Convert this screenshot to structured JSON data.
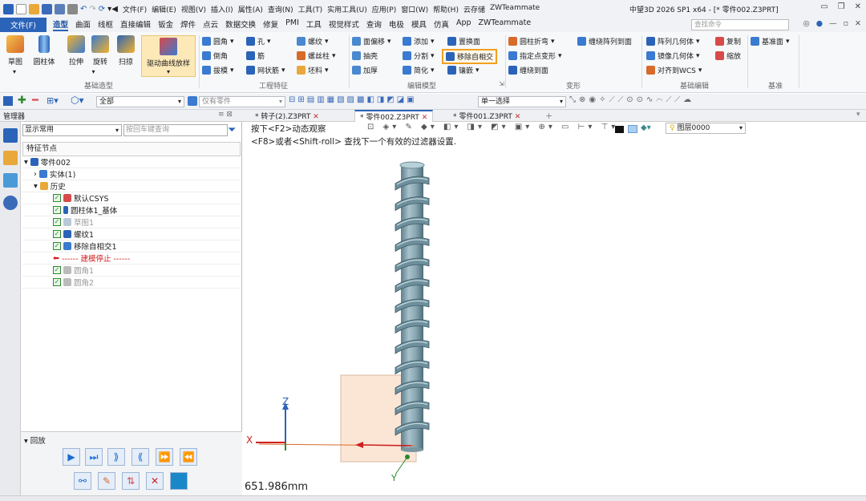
{
  "titlebar": {
    "menus": [
      "文件(F)",
      "编辑(E)",
      "视图(V)",
      "插入(I)",
      "属性(A)",
      "查询(N)",
      "工具(T)",
      "实用工具(U)",
      "应用(P)",
      "窗口(W)",
      "帮助(H)",
      "云存储",
      "ZWTeammate"
    ],
    "window_title": "中望3D 2026 SP1 x64 - [* 零件002.Z3PRT]"
  },
  "tabbar": {
    "file": "文件(F)",
    "tabs": [
      "造型",
      "曲面",
      "线框",
      "直接编辑",
      "钣金",
      "焊件",
      "点云",
      "数据交换",
      "修复",
      "PMI",
      "工具",
      "视觉样式",
      "查询",
      "电极",
      "模具",
      "仿真",
      "App",
      "ZWTeammate"
    ],
    "active": "造型",
    "search_placeholder": "查找命令"
  },
  "ribbon": {
    "big": [
      "草图",
      "圆柱体",
      "拉伸",
      "旋转",
      "扫掠"
    ],
    "drive": "驱动曲线放样",
    "groups": [
      "基础造型",
      "工程特征",
      "编辑模型",
      "变形",
      "基础编辑",
      "基准"
    ],
    "eng": [
      "圆角",
      "孔",
      "螺纹",
      "倒角",
      "筋",
      "螺丝柱",
      "拔模",
      "网状筋",
      "坯料"
    ],
    "edit": [
      "面偏移",
      "添加",
      "置换面",
      "抽壳",
      "分割",
      "移除自相交",
      "加厚",
      "简化",
      "镶嵌"
    ],
    "deform": [
      "圆柱折弯",
      "缠绕阵列到面",
      "指定点变形",
      "缠绕到面"
    ],
    "basic": [
      "阵列几何体",
      "复制",
      "镜像几何体",
      "缩放",
      "对齐到WCS"
    ],
    "datum": "基准面"
  },
  "toolbar2": {
    "filter": "全部",
    "parts": "仅有零件",
    "select": "单一选择"
  },
  "doctabs": {
    "manager": "管理器",
    "tabs": [
      "* 转子(2).Z3PRT",
      "* 零件002.Z3PRT",
      "* 零件001.Z3PRT"
    ]
  },
  "panel": {
    "filter": "显示常用",
    "search": "按回车键查询",
    "header": "特征节点",
    "tree": {
      "root": "零件002",
      "solid": "实体(1)",
      "history": "历史",
      "items": [
        "默认CSYS",
        "圆柱体1_基体",
        "草图1",
        "螺纹1",
        "移除自相交1"
      ],
      "stop": "------ 建模停止 ------",
      "after": [
        "圆角1",
        "圆角2"
      ]
    }
  },
  "playback": {
    "title": "回放"
  },
  "viewport": {
    "hint1": "按下<F2>动态观察",
    "hint2": "<F8>或者<Shift-roll> 查找下一个有效的过滤器设置.",
    "layer": "图层0000",
    "measure": "651.986mm",
    "axes": [
      "Z",
      "X",
      "Y"
    ]
  }
}
